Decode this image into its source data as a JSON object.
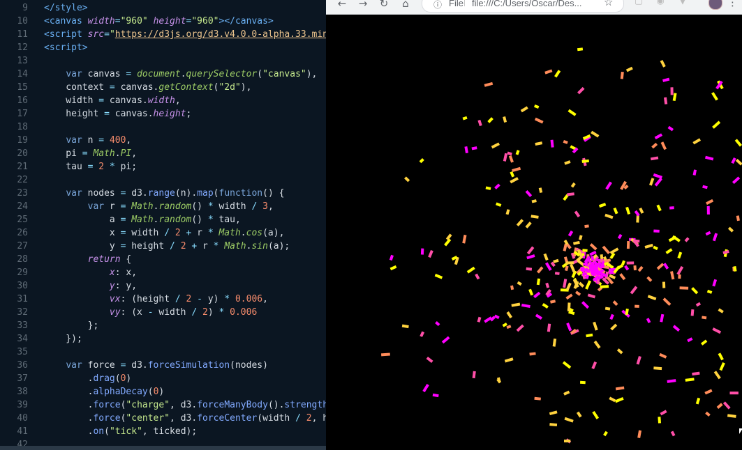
{
  "editor": {
    "lines": [
      {
        "n": "9",
        "t": [
          [
            "tag",
            "</style>"
          ]
        ]
      },
      {
        "n": "10",
        "t": [
          [
            "tag",
            "<canvas "
          ],
          [
            "attr",
            "width"
          ],
          [
            "op",
            "="
          ],
          [
            "str",
            "\"960\""
          ],
          [
            "plain",
            " "
          ],
          [
            "attr",
            "height"
          ],
          [
            "op",
            "="
          ],
          [
            "str",
            "\"960\""
          ],
          [
            "tag",
            "></canvas>"
          ]
        ]
      },
      {
        "n": "11",
        "t": [
          [
            "tag",
            "<script "
          ],
          [
            "attr",
            "src"
          ],
          [
            "op",
            "="
          ],
          [
            "str",
            "\""
          ],
          [
            "url",
            "https://d3js.org/d3.v4.0.0-alpha.33.min."
          ]
        ]
      },
      {
        "n": "12",
        "t": [
          [
            "tag",
            "<script>"
          ]
        ]
      },
      {
        "n": "13",
        "t": []
      },
      {
        "n": "14",
        "t": [
          [
            "plain",
            "    "
          ],
          [
            "kw",
            "var"
          ],
          [
            "plain",
            " canvas "
          ],
          [
            "op",
            "="
          ],
          [
            "plain",
            " "
          ],
          [
            "fn",
            "document"
          ],
          [
            "plain",
            "."
          ],
          [
            "fn",
            "querySelector"
          ],
          [
            "plain",
            "("
          ],
          [
            "str",
            "\"canvas\""
          ],
          [
            "plain",
            "),"
          ]
        ]
      },
      {
        "n": "15",
        "t": [
          [
            "plain",
            "    context "
          ],
          [
            "op",
            "="
          ],
          [
            "plain",
            " canvas."
          ],
          [
            "fn",
            "getContext"
          ],
          [
            "plain",
            "("
          ],
          [
            "str",
            "\"2d\""
          ],
          [
            "plain",
            "),"
          ]
        ]
      },
      {
        "n": "16",
        "t": [
          [
            "plain",
            "    width "
          ],
          [
            "op",
            "="
          ],
          [
            "plain",
            " canvas."
          ],
          [
            "prop",
            "width"
          ],
          [
            "plain",
            ","
          ]
        ]
      },
      {
        "n": "17",
        "t": [
          [
            "plain",
            "    height "
          ],
          [
            "op",
            "="
          ],
          [
            "plain",
            " canvas."
          ],
          [
            "prop",
            "height"
          ],
          [
            "plain",
            ";"
          ]
        ]
      },
      {
        "n": "18",
        "t": []
      },
      {
        "n": "19",
        "t": [
          [
            "plain",
            "    "
          ],
          [
            "kw",
            "var"
          ],
          [
            "plain",
            " n "
          ],
          [
            "op",
            "="
          ],
          [
            "plain",
            " "
          ],
          [
            "num",
            "400"
          ],
          [
            "plain",
            ","
          ]
        ]
      },
      {
        "n": "20",
        "t": [
          [
            "plain",
            "    pi "
          ],
          [
            "op",
            "="
          ],
          [
            "plain",
            " "
          ],
          [
            "fn",
            "Math"
          ],
          [
            "plain",
            "."
          ],
          [
            "fn",
            "PI"
          ],
          [
            "plain",
            ","
          ]
        ]
      },
      {
        "n": "21",
        "t": [
          [
            "plain",
            "    tau "
          ],
          [
            "op",
            "="
          ],
          [
            "plain",
            " "
          ],
          [
            "num",
            "2"
          ],
          [
            "plain",
            " "
          ],
          [
            "op",
            "*"
          ],
          [
            "plain",
            " pi;"
          ]
        ]
      },
      {
        "n": "22",
        "t": []
      },
      {
        "n": "23",
        "t": [
          [
            "plain",
            "    "
          ],
          [
            "kw",
            "var"
          ],
          [
            "plain",
            " nodes "
          ],
          [
            "op",
            "="
          ],
          [
            "plain",
            " d3."
          ],
          [
            "meth",
            "range"
          ],
          [
            "plain",
            "(n)."
          ],
          [
            "meth",
            "map"
          ],
          [
            "plain",
            "("
          ],
          [
            "kw",
            "function"
          ],
          [
            "plain",
            "() {"
          ]
        ]
      },
      {
        "n": "24",
        "t": [
          [
            "plain",
            "        "
          ],
          [
            "kw",
            "var"
          ],
          [
            "plain",
            " r "
          ],
          [
            "op",
            "="
          ],
          [
            "plain",
            " "
          ],
          [
            "fn",
            "Math"
          ],
          [
            "plain",
            "."
          ],
          [
            "fn",
            "random"
          ],
          [
            "plain",
            "() "
          ],
          [
            "op",
            "*"
          ],
          [
            "plain",
            " width "
          ],
          [
            "op",
            "/"
          ],
          [
            "plain",
            " "
          ],
          [
            "num",
            "3"
          ],
          [
            "plain",
            ","
          ]
        ]
      },
      {
        "n": "25",
        "t": [
          [
            "plain",
            "            a "
          ],
          [
            "op",
            "="
          ],
          [
            "plain",
            " "
          ],
          [
            "fn",
            "Math"
          ],
          [
            "plain",
            "."
          ],
          [
            "fn",
            "random"
          ],
          [
            "plain",
            "() "
          ],
          [
            "op",
            "*"
          ],
          [
            "plain",
            " tau,"
          ]
        ]
      },
      {
        "n": "26",
        "t": [
          [
            "plain",
            "            x "
          ],
          [
            "op",
            "="
          ],
          [
            "plain",
            " width "
          ],
          [
            "op",
            "/"
          ],
          [
            "plain",
            " "
          ],
          [
            "num",
            "2"
          ],
          [
            "plain",
            " "
          ],
          [
            "op",
            "+"
          ],
          [
            "plain",
            " r "
          ],
          [
            "op",
            "*"
          ],
          [
            "plain",
            " "
          ],
          [
            "fn",
            "Math"
          ],
          [
            "plain",
            "."
          ],
          [
            "fn",
            "cos"
          ],
          [
            "plain",
            "(a),"
          ]
        ]
      },
      {
        "n": "27",
        "t": [
          [
            "plain",
            "            y "
          ],
          [
            "op",
            "="
          ],
          [
            "plain",
            " height "
          ],
          [
            "op",
            "/"
          ],
          [
            "plain",
            " "
          ],
          [
            "num",
            "2"
          ],
          [
            "plain",
            " "
          ],
          [
            "op",
            "+"
          ],
          [
            "plain",
            " r "
          ],
          [
            "op",
            "*"
          ],
          [
            "plain",
            " "
          ],
          [
            "fn",
            "Math"
          ],
          [
            "plain",
            "."
          ],
          [
            "fn",
            "sin"
          ],
          [
            "plain",
            "(a);"
          ]
        ]
      },
      {
        "n": "28",
        "t": [
          [
            "plain",
            "        "
          ],
          [
            "ret",
            "return"
          ],
          [
            "plain",
            " {"
          ]
        ]
      },
      {
        "n": "29",
        "t": [
          [
            "plain",
            "            "
          ],
          [
            "prop",
            "x"
          ],
          [
            "plain",
            ": x,"
          ]
        ]
      },
      {
        "n": "30",
        "t": [
          [
            "plain",
            "            "
          ],
          [
            "prop",
            "y"
          ],
          [
            "plain",
            ": y,"
          ]
        ]
      },
      {
        "n": "31",
        "t": [
          [
            "plain",
            "            "
          ],
          [
            "prop",
            "vx"
          ],
          [
            "plain",
            ": (height "
          ],
          [
            "op",
            "/"
          ],
          [
            "plain",
            " "
          ],
          [
            "num",
            "2"
          ],
          [
            "plain",
            " "
          ],
          [
            "op",
            "-"
          ],
          [
            "plain",
            " y) "
          ],
          [
            "op",
            "*"
          ],
          [
            "plain",
            " "
          ],
          [
            "num",
            "0.006"
          ],
          [
            "plain",
            ","
          ]
        ]
      },
      {
        "n": "32",
        "t": [
          [
            "plain",
            "            "
          ],
          [
            "prop",
            "vy"
          ],
          [
            "plain",
            ": (x "
          ],
          [
            "op",
            "-"
          ],
          [
            "plain",
            " width "
          ],
          [
            "op",
            "/"
          ],
          [
            "plain",
            " "
          ],
          [
            "num",
            "2"
          ],
          [
            "plain",
            ") "
          ],
          [
            "op",
            "*"
          ],
          [
            "plain",
            " "
          ],
          [
            "num",
            "0.006"
          ]
        ]
      },
      {
        "n": "33",
        "t": [
          [
            "plain",
            "        };"
          ]
        ]
      },
      {
        "n": "34",
        "t": [
          [
            "plain",
            "    });"
          ]
        ]
      },
      {
        "n": "35",
        "t": []
      },
      {
        "n": "36",
        "t": [
          [
            "plain",
            "    "
          ],
          [
            "kw",
            "var"
          ],
          [
            "plain",
            " force "
          ],
          [
            "op",
            "="
          ],
          [
            "plain",
            " d3."
          ],
          [
            "meth",
            "forceSimulation"
          ],
          [
            "plain",
            "(nodes)"
          ]
        ]
      },
      {
        "n": "37",
        "t": [
          [
            "plain",
            "        ."
          ],
          [
            "meth",
            "drag"
          ],
          [
            "plain",
            "("
          ],
          [
            "num",
            "0"
          ],
          [
            "plain",
            ")"
          ]
        ]
      },
      {
        "n": "38",
        "t": [
          [
            "plain",
            "        ."
          ],
          [
            "meth",
            "alphaDecay"
          ],
          [
            "plain",
            "("
          ],
          [
            "num",
            "0"
          ],
          [
            "plain",
            ")"
          ]
        ]
      },
      {
        "n": "39",
        "t": [
          [
            "plain",
            "        ."
          ],
          [
            "meth",
            "force"
          ],
          [
            "plain",
            "("
          ],
          [
            "str",
            "\"charge\""
          ],
          [
            "plain",
            ", d3."
          ],
          [
            "meth",
            "forceManyBody"
          ],
          [
            "plain",
            "()."
          ],
          [
            "meth",
            "strength"
          ],
          [
            "plain",
            "("
          ]
        ]
      },
      {
        "n": "40",
        "t": [
          [
            "plain",
            "        ."
          ],
          [
            "meth",
            "force"
          ],
          [
            "plain",
            "("
          ],
          [
            "str",
            "\"center\""
          ],
          [
            "plain",
            ", d3."
          ],
          [
            "meth",
            "forceCenter"
          ],
          [
            "plain",
            "(width "
          ],
          [
            "op",
            "/"
          ],
          [
            "plain",
            " "
          ],
          [
            "num",
            "2"
          ],
          [
            "plain",
            ", he"
          ]
        ]
      },
      {
        "n": "41",
        "t": [
          [
            "plain",
            "        ."
          ],
          [
            "meth",
            "on"
          ],
          [
            "plain",
            "("
          ],
          [
            "str",
            "\"tick\""
          ],
          [
            "plain",
            ", ticked);"
          ]
        ]
      },
      {
        "n": "42",
        "t": []
      }
    ]
  },
  "browser": {
    "back_icon": "arrow-left-icon",
    "forward_icon": "arrow-right-icon",
    "reload_icon": "reload-icon",
    "home_icon": "home-icon",
    "info_icon": "info-icon",
    "protocol_label": "File",
    "url": "file:///C:/Users/Oscar/Des...",
    "star_icon": "star-icon",
    "menu_icon": "menu-icon"
  },
  "visualization": {
    "colors": [
      "#ff00ff",
      "#ff4fa8",
      "#ff8c5a",
      "#ffd23f",
      "#ffff00"
    ],
    "particle_count": 400
  }
}
